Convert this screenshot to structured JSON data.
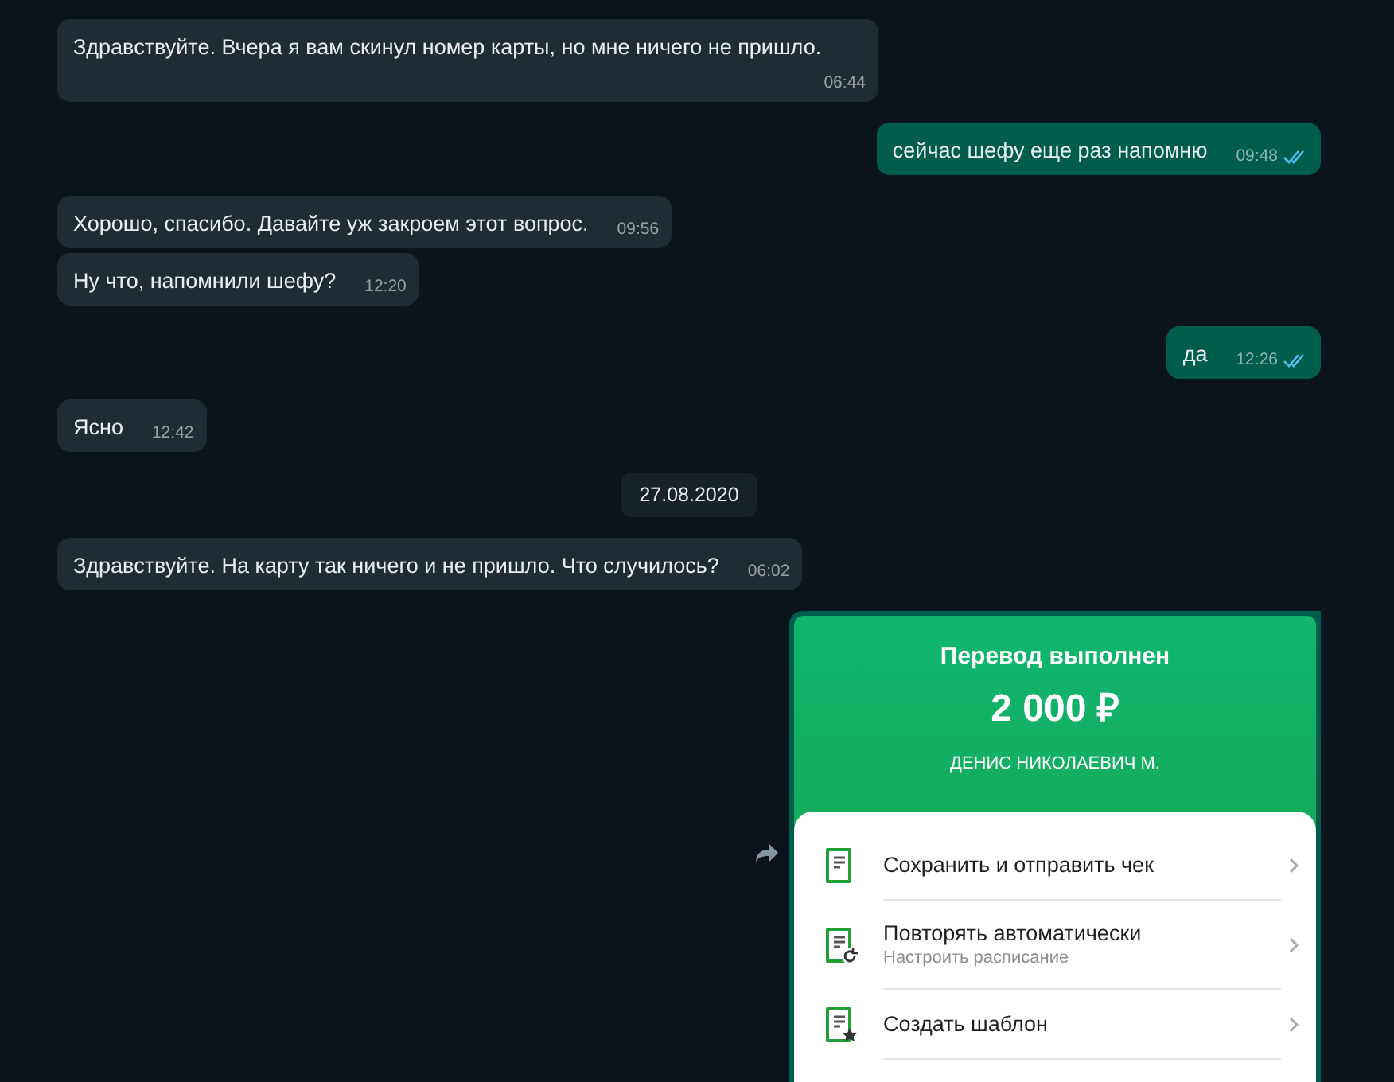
{
  "messages": [
    {
      "kind": "incoming",
      "text": "Здравствуйте. Вчера я вам скинул номер карты, но мне ничего не пришло.",
      "time": "06:44"
    },
    {
      "kind": "outgoing",
      "text": "сейчас шефу еще раз напомню",
      "time": "09:48",
      "read": true
    },
    {
      "kind": "incoming",
      "text": "Хорошо, спасибо. Давайте уж закроем этот вопрос.",
      "time": "09:56"
    },
    {
      "kind": "incoming",
      "text": "Ну что, напомнили шефу?",
      "time": "12:20"
    },
    {
      "kind": "outgoing",
      "text": "да",
      "time": "12:26",
      "read": true
    },
    {
      "kind": "incoming",
      "text": "Ясно",
      "time": "12:42"
    },
    {
      "kind": "date",
      "text": "27.08.2020"
    },
    {
      "kind": "incoming",
      "text": "Здравствуйте. На карту так ничего и не пришло. Что случилось?",
      "time": "06:02"
    },
    {
      "kind": "receipt",
      "title": "Перевод выполнен",
      "amount": "2 000 ₽",
      "recipient": "ДЕНИС НИКОЛАЕВИЧ М.",
      "actions": [
        {
          "kind": "save",
          "label": "Сохранить и отправить чек"
        },
        {
          "kind": "repeat",
          "label": "Повторять автоматически",
          "sublabel": "Настроить расписание"
        },
        {
          "kind": "template",
          "label": "Создать шаблон"
        }
      ]
    }
  ]
}
